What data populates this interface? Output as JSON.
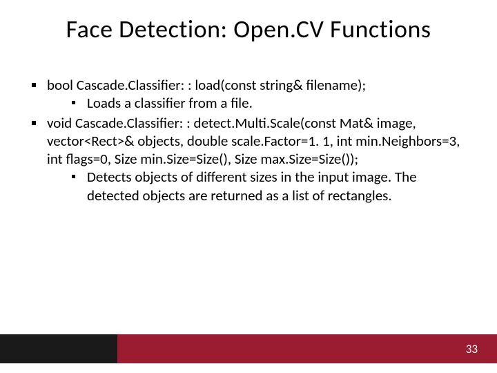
{
  "title": "Face Detection: Open.CV Functions",
  "bullets": {
    "b1": "bool Cascade.Classifier: : load(const string& filename);",
    "b1_sub": "Loads a classifier from a file.",
    "b2": "void Cascade.Classifier: : detect.Multi.Scale(const Mat& image, vector<Rect>& objects, double scale.Factor=1. 1, int min.Neighbors=3, int flags=0, Size min.Size=Size(), Size max.Size=Size());",
    "b2_sub": "Detects objects of different sizes in the input image. The detected objects are returned as a list of rectangles."
  },
  "page_number": "33"
}
